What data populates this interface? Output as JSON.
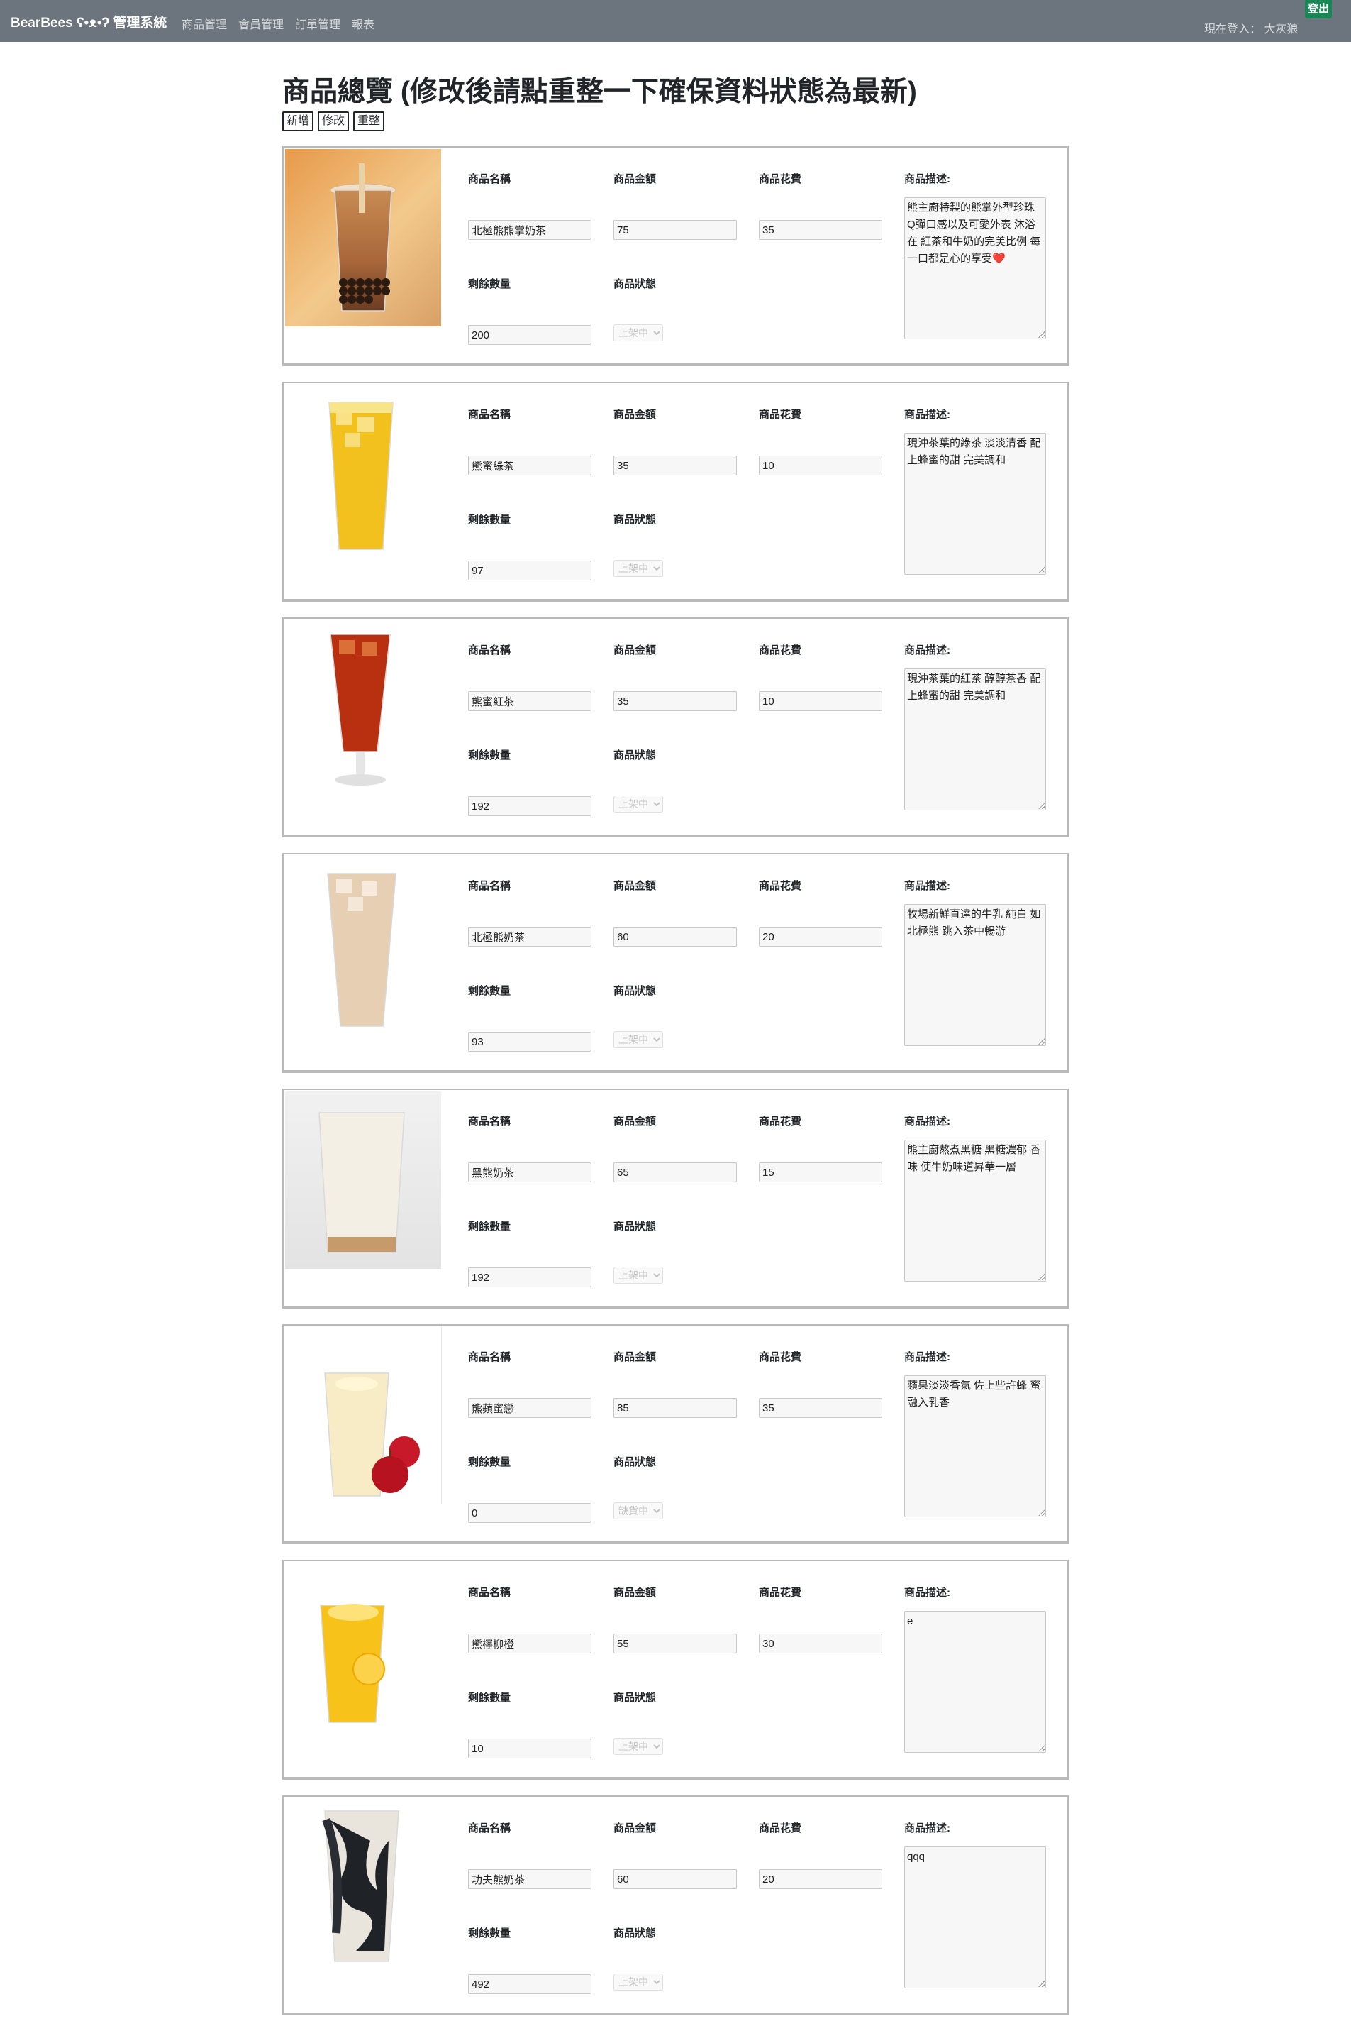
{
  "navbar": {
    "brand": "BearBees ʕ•ᴥ•ʔ 管理系統",
    "links": [
      "商品管理",
      "會員管理",
      "訂單管理",
      "報表"
    ],
    "login_status": "現在登入： 大灰狼",
    "logout_label": "登出"
  },
  "page": {
    "title": "商品總覽 (修改後請點重整一下確保資料狀態為最新)",
    "actions": {
      "add": "新增",
      "edit": "修改",
      "refresh": "重整"
    }
  },
  "labels": {
    "name": "商品名稱",
    "price": "商品金額",
    "cost": "商品花費",
    "description": "商品描述:",
    "stock": "剩餘數量",
    "status": "商品狀態"
  },
  "products": [
    {
      "name": "北極熊熊掌奶茶",
      "price": "75",
      "cost": "35",
      "stock": "200",
      "status": "上架中",
      "description": "熊主廚特製的熊掌外型珍珠 Q彈口感以及可愛外表 沐浴在 紅茶和牛奶的完美比例 每一口都是心的享受❤️",
      "image": "bubble-tea-photo"
    },
    {
      "name": "熊蜜綠茶",
      "price": "35",
      "cost": "10",
      "stock": "97",
      "status": "上架中",
      "description": "現沖茶葉的綠茶 淡淡清香 配上蜂蜜的甜 完美調和",
      "image": "honey-green-tea-photo"
    },
    {
      "name": "熊蜜紅茶",
      "price": "35",
      "cost": "10",
      "stock": "192",
      "status": "上架中",
      "description": "現沖茶葉的紅茶 醇醇茶香 配上蜂蜜的甜 完美調和",
      "image": "honey-black-tea-photo"
    },
    {
      "name": "北極熊奶茶",
      "price": "60",
      "cost": "20",
      "stock": "93",
      "status": "上架中",
      "description": "牧場新鮮直達的牛乳 純白 如北極熊 跳入茶中暢游",
      "image": "milk-tea-photo"
    },
    {
      "name": "黑熊奶茶",
      "price": "65",
      "cost": "15",
      "stock": "192",
      "status": "上架中",
      "description": "熊主廚熬煮黑糖 黑糖濃郁 香味 使牛奶味道昇華一層",
      "image": "brown-sugar-milk-photo"
    },
    {
      "name": "熊蘋蜜戀",
      "price": "85",
      "cost": "35",
      "stock": "0",
      "status": "缺貨中",
      "description": "蘋果淡淡香氣 佐上些許蜂 蜜 融入乳香",
      "image": "apple-honey-milk-photo"
    },
    {
      "name": "熊檸柳橙",
      "price": "55",
      "cost": "30",
      "stock": "10",
      "status": "上架中",
      "description": "e",
      "image": "lemon-orange-photo"
    },
    {
      "name": "功夫熊奶茶",
      "price": "60",
      "cost": "20",
      "stock": "492",
      "status": "上架中",
      "description": "qqq",
      "image": "grass-jelly-milk-tea-photo"
    }
  ]
}
